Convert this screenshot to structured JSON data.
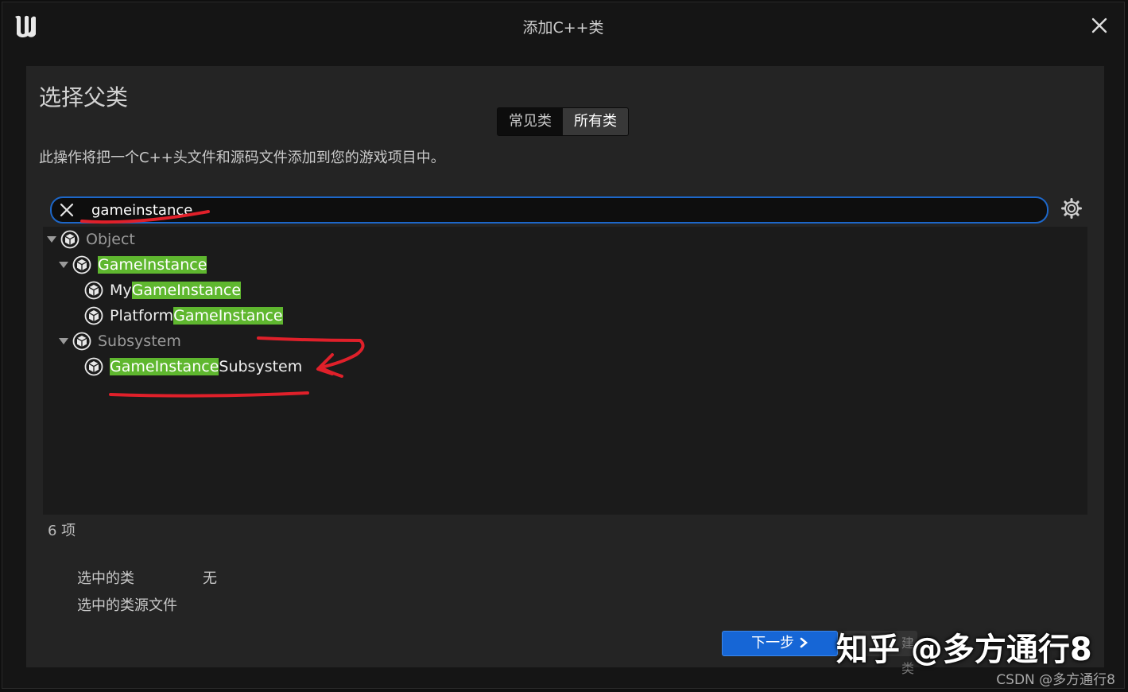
{
  "window": {
    "title": "添加C++类"
  },
  "dialog": {
    "heading": "选择父类",
    "tabs": [
      {
        "label": "常见类",
        "active": false
      },
      {
        "label": "所有类",
        "active": true
      }
    ],
    "description": "此操作将把一个C++头文件和源码文件添加到您的游戏项目中。"
  },
  "search": {
    "value": "gameinstance"
  },
  "tree": {
    "object": {
      "label": "Object"
    },
    "game_instance": {
      "label": "GameInstance",
      "hl": "GameInstance"
    },
    "my_game_instance": {
      "pre": "My",
      "hl": "GameInstance"
    },
    "platform_game_instance": {
      "pre": "Platform",
      "hl": "GameInstance"
    },
    "subsystem": {
      "label": "Subsystem"
    },
    "game_instance_subsystem": {
      "hl": "GameInstance",
      "post": "Subsystem"
    }
  },
  "footer": {
    "item_count": "6 项",
    "selected_class_label": "选中的类",
    "selected_class_value": "无",
    "selected_source_label": "选中的类源文件",
    "next_button": "下一步",
    "create_button_partial": "建类"
  },
  "watermarks": {
    "zhihu": "知乎 @多方通行8",
    "csdn": "CSDN @多方通行8"
  },
  "colors": {
    "accent": "#1d67c9",
    "highlight": "#5fb72f",
    "annotation": "#e0202a"
  }
}
